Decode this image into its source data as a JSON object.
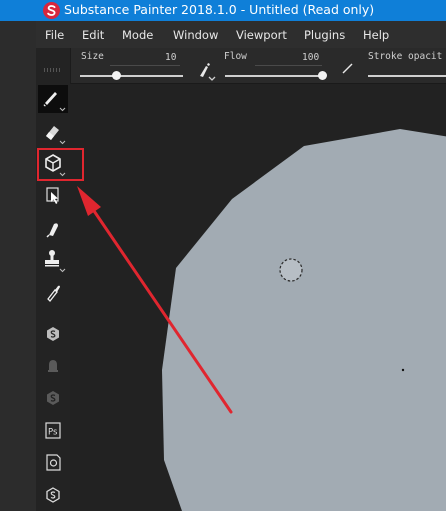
{
  "titlebar": {
    "title": "Substance Painter 2018.1.0 - Untitled (Read only)",
    "background": "#0f7fd8"
  },
  "menu": {
    "items": [
      "File",
      "Edit",
      "Mode",
      "Window",
      "Viewport",
      "Plugins",
      "Help"
    ]
  },
  "toolbar": {
    "size_label": "Size",
    "size_value": "10",
    "size_level": 0.35,
    "flow_label": "Flow",
    "flow_value": "100",
    "flow_level": 1.0,
    "stroke_label": "Stroke opacit"
  },
  "tools": [
    {
      "name": "paint-brush-tool",
      "active": true
    },
    {
      "name": "eraser-tool"
    },
    {
      "name": "projection-tool",
      "highlighted": true
    },
    {
      "name": "polygon-fill-tool"
    },
    {
      "name": "smudge-tool"
    },
    {
      "name": "clone-tool"
    },
    {
      "name": "color-picker-tool"
    },
    {
      "name": "substance-source-icon"
    },
    {
      "name": "bake-icon"
    },
    {
      "name": "substance-plugin-icon"
    },
    {
      "name": "photoshop-export-icon",
      "label": "Ps"
    },
    {
      "name": "screenshot-icon"
    },
    {
      "name": "substance-share-icon"
    }
  ],
  "colors": {
    "mesh": "#a2abb3",
    "annotation": "#e0262f",
    "viewport_bg": "#222222"
  }
}
